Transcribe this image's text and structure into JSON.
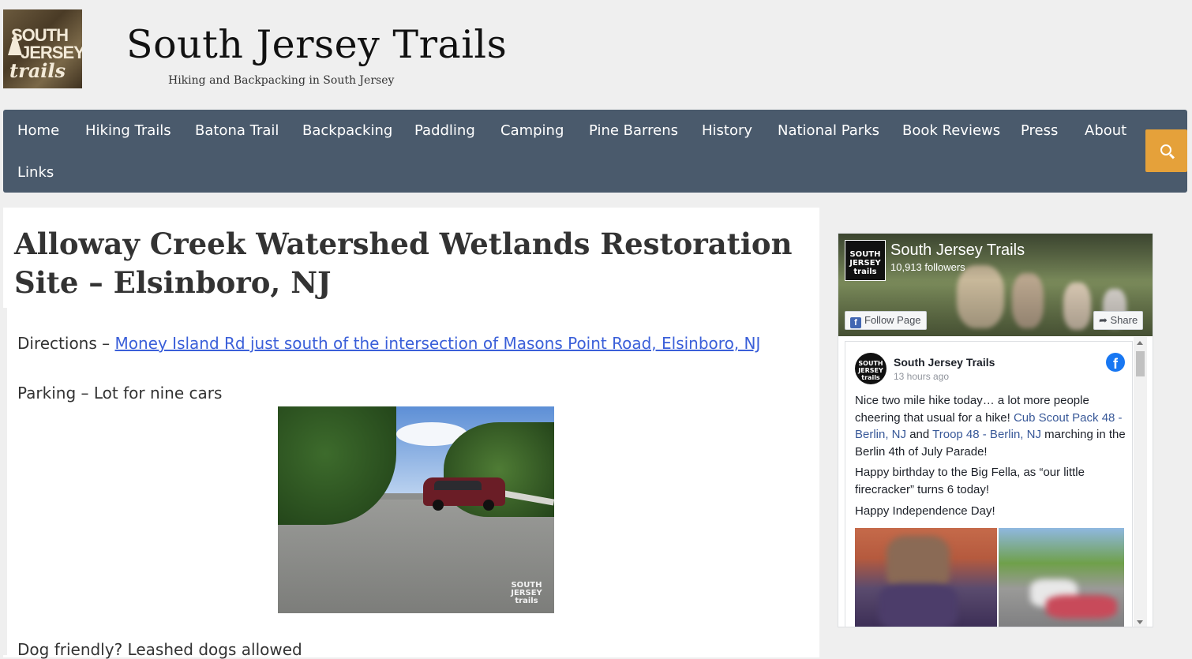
{
  "site": {
    "logo_lines": [
      "SOUTH",
      "JERSEY",
      "trails"
    ],
    "title": "South Jersey Trails",
    "tagline": "Hiking and Backpacking in South Jersey"
  },
  "nav": {
    "items": [
      "Home",
      "Hiking Trails",
      "Batona Trail",
      "Backpacking",
      "Paddling",
      "Camping",
      "Pine Barrens",
      "History",
      "National Parks",
      "Book Reviews",
      "Press",
      "About",
      "Links"
    ],
    "search_icon": "search-icon",
    "search_color": "#e5a13a",
    "bar_color": "#4a5a6c"
  },
  "article": {
    "title": "Alloway Creek Watershed Wetlands Restoration Site – Elsinboro, NJ",
    "directions_label": "Directions – ",
    "directions_link": "Money Island Rd just south of the intersection of Masons Point Road, Elsinboro, NJ",
    "parking": "Parking – Lot for nine cars",
    "dogs": "Dog friendly? Leashed dogs allowed",
    "photo_watermark": "SOUTH JERSEY trails",
    "link_color": "#3a5fd9"
  },
  "facebook": {
    "page_name": "South Jersey Trails",
    "followers": "10,913 followers",
    "follow_button": "Follow Page",
    "share_button": "Share",
    "post": {
      "author": "South Jersey Trails",
      "time": "13 hours ago",
      "p1_a": "Nice two mile hike today… a lot more people cheering that usual for a hike! ",
      "p1_link1": "Cub Scout Pack 48 - Berlin, NJ",
      "p1_and": " and ",
      "p1_link2": "Troop 48 - Berlin, NJ",
      "p1_b": " marching in the Berlin 4th of July Parade!",
      "p2": "Happy birthday to the Big Fella, as “our little firecracker” turns 6 today!",
      "p3": "Happy Independence Day!"
    },
    "brand_color": "#1877f2"
  }
}
